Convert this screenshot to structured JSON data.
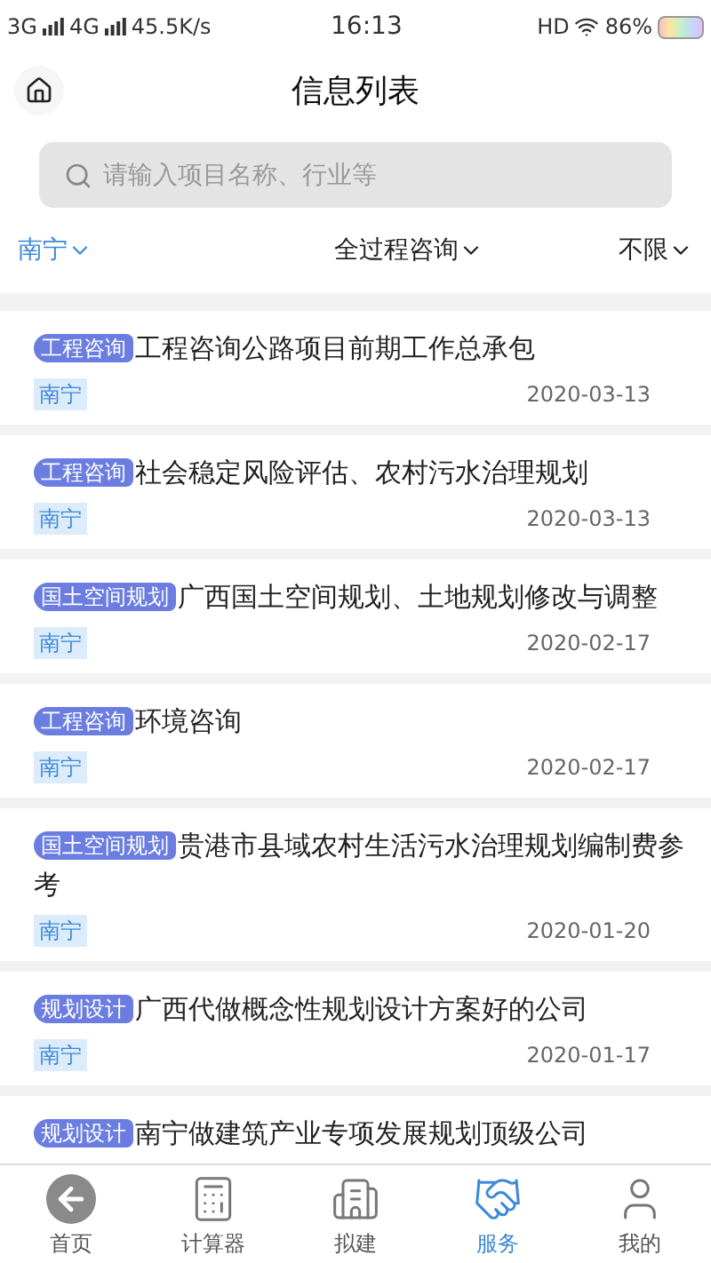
{
  "status_bar": {
    "network_1": "3G",
    "network_2": "4G",
    "speed": "45.5K/s",
    "time": "16:13",
    "hd": "HD",
    "battery": "86%"
  },
  "header": {
    "title": "信息列表"
  },
  "search": {
    "placeholder": "请输入项目名称、行业等"
  },
  "filters": [
    {
      "label": "南宁",
      "selected": true
    },
    {
      "label": "全过程咨询",
      "selected": false
    },
    {
      "label": "不限",
      "selected": false
    }
  ],
  "items": [
    {
      "tag": "工程咨询",
      "title": "工程咨询公路项目前期工作总承包",
      "location": "南宁",
      "date": "2020-03-13"
    },
    {
      "tag": "工程咨询",
      "title": "社会稳定风险评估、农村污水治理规划",
      "location": "南宁",
      "date": "2020-03-13"
    },
    {
      "tag": "国土空间规划",
      "title": "广西国土空间规划、土地规划修改与调整",
      "location": "南宁",
      "date": "2020-02-17"
    },
    {
      "tag": "工程咨询",
      "title": "环境咨询",
      "location": "南宁",
      "date": "2020-02-17"
    },
    {
      "tag": "国土空间规划",
      "title": "贵港市县域农村生活污水治理规划编制费参考",
      "location": "南宁",
      "date": "2020-01-20"
    },
    {
      "tag": "规划设计",
      "title": "广西代做概念性规划设计方案好的公司",
      "location": "南宁",
      "date": "2020-01-17"
    },
    {
      "tag": "规划设计",
      "title": "南宁做建筑产业专项发展规划顶级公司"
    }
  ],
  "tab_bar": [
    {
      "kind": "home",
      "label": "首页",
      "selected": false
    },
    {
      "kind": "calculator",
      "label": "计算器",
      "selected": false
    },
    {
      "kind": "building",
      "label": "拟建",
      "selected": false
    },
    {
      "kind": "handshake",
      "label": "服务",
      "selected": true
    },
    {
      "kind": "user",
      "label": "我的",
      "selected": false
    }
  ]
}
